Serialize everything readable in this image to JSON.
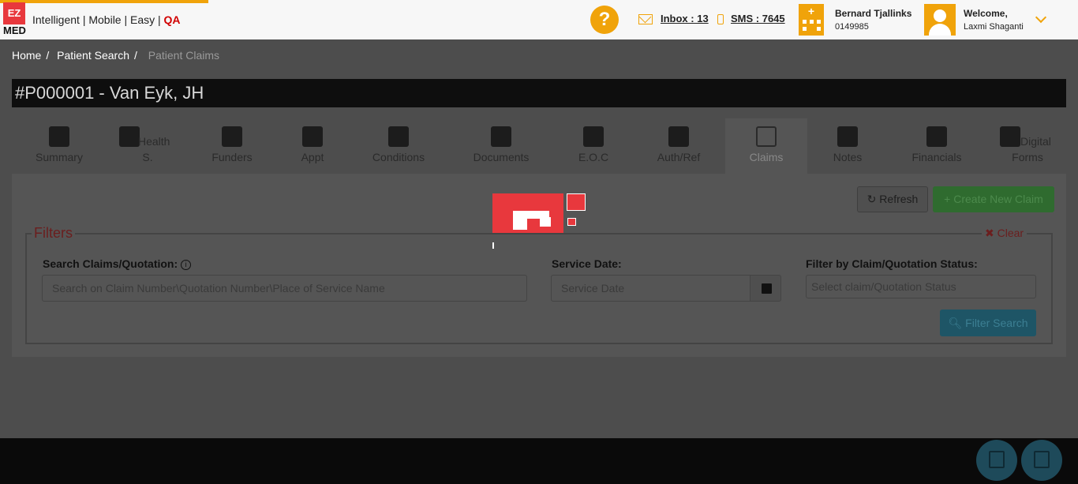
{
  "app": {
    "logo_top": "EZ",
    "logo_bottom": "MED",
    "tagline": "Intelligent | Mobile | Easy | ",
    "env": "QA",
    "help_label": "?",
    "inbox_label": "Inbox : 13",
    "sms_label": "SMS : 7645",
    "practice_name": "Bernard Tjallinks",
    "practice_code": "0149985",
    "welcome_title": "Welcome,",
    "welcome_name": "Laxmi Shaganti"
  },
  "breadcrumb": {
    "items": [
      "Home",
      "Patient Search",
      "Patient Claims"
    ],
    "separator": "/"
  },
  "patient": {
    "title": "#P000001 - Van Eyk, JH"
  },
  "tabs": [
    {
      "label": "Summary",
      "icon": "id-card-icon"
    },
    {
      "label_a": "Health",
      "label_b": "S.",
      "icon": "medical-plus-icon"
    },
    {
      "label": "Funders",
      "icon": "gears-icon"
    },
    {
      "label": "Appt",
      "icon": "calendar-check-icon"
    },
    {
      "label": "Conditions",
      "icon": "user-md-icon"
    },
    {
      "label": "Documents",
      "icon": "briefcase-icon"
    },
    {
      "label": "E.O.C",
      "icon": "user-md-icon"
    },
    {
      "label": "Auth/Ref",
      "icon": "key-icon"
    },
    {
      "label": "Claims",
      "icon": "copy-icon"
    },
    {
      "label": "Notes",
      "icon": "notes-icon"
    },
    {
      "label": "Financials",
      "icon": "financials-icon"
    },
    {
      "label_a": "Digital",
      "label_b": "Forms",
      "icon": "digital-forms-icon"
    }
  ],
  "actions": {
    "refresh": "Refresh",
    "create": "Create New Claim"
  },
  "filters": {
    "legend": "Filters",
    "clear": "Clear",
    "search_label": "Search Claims/Quotation:",
    "search_placeholder": "Search on Claim Number\\Quotation Number\\Place of Service Name",
    "service_date_label": "Service Date:",
    "service_date_placeholder": "Service Date",
    "status_label": "Filter by Claim/Quotation Status:",
    "status_placeholder": "Select claim/Quotation Status",
    "submit": "Filter Search"
  },
  "colors": {
    "accent": "#f0a30a",
    "brand_red": "#e8383d",
    "overlay": "#4d4d4d"
  }
}
